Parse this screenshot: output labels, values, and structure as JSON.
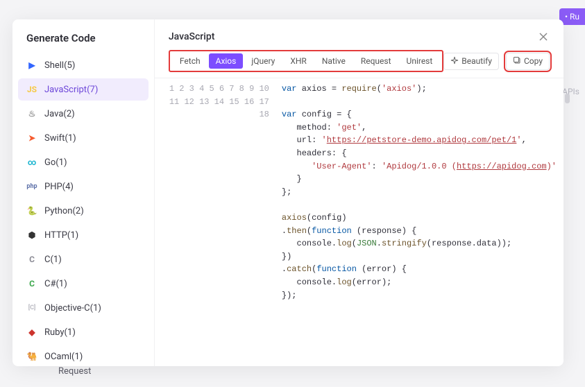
{
  "bg": {
    "run_btn": "Ru",
    "apis": "APIs",
    "request": "Request"
  },
  "sidebar": {
    "title": "Generate Code",
    "items": [
      {
        "label": "Shell(5)",
        "icon_name": "shell-icon",
        "icon_glyph": "▶",
        "icon_color": "#3366ff"
      },
      {
        "label": "JavaScript(7)",
        "icon_name": "javascript-icon",
        "icon_glyph": "JS",
        "icon_color": "#f6c945",
        "selected": true
      },
      {
        "label": "Java(2)",
        "icon_name": "java-icon",
        "icon_glyph": "♨",
        "icon_color": "#999"
      },
      {
        "label": "Swift(1)",
        "icon_name": "swift-icon",
        "icon_glyph": "➤",
        "icon_color": "#f55b2f"
      },
      {
        "label": "Go(1)",
        "icon_name": "go-icon",
        "icon_glyph": "∞",
        "icon_color": "#1fb6d0"
      },
      {
        "label": "PHP(4)",
        "icon_name": "php-icon",
        "icon_glyph": "php",
        "icon_color": "#5b6fa8"
      },
      {
        "label": "Python(2)",
        "icon_name": "python-icon",
        "icon_glyph": "🐍",
        "icon_color": "#3776ab"
      },
      {
        "label": "HTTP(1)",
        "icon_name": "http-icon",
        "icon_glyph": "⬢",
        "icon_color": "#333"
      },
      {
        "label": "C(1)",
        "icon_name": "c-icon",
        "icon_glyph": "C",
        "icon_color": "#8a8a94"
      },
      {
        "label": "C#(1)",
        "icon_name": "csharp-icon",
        "icon_glyph": "C",
        "icon_color": "#3aa64a"
      },
      {
        "label": "Objective-C(1)",
        "icon_name": "objc-icon",
        "icon_glyph": "[C]",
        "icon_color": "#bcbcc4"
      },
      {
        "label": "Ruby(1)",
        "icon_name": "ruby-icon",
        "icon_glyph": "◆",
        "icon_color": "#cc342d"
      },
      {
        "label": "OCaml(1)",
        "icon_name": "ocaml-icon",
        "icon_glyph": "🐫",
        "icon_color": "#e98b2d"
      }
    ]
  },
  "main": {
    "title": "JavaScript",
    "tabs": [
      "Fetch",
      "Axios",
      "jQuery",
      "XHR",
      "Native",
      "Request",
      "Unirest"
    ],
    "active_tab": "Axios",
    "actions": {
      "beautify": "Beautify",
      "copy": "Copy"
    }
  },
  "code": {
    "line_count": 18,
    "tokens": [
      [
        {
          "t": "kw",
          "v": "var"
        },
        {
          "t": "sp",
          "v": " "
        },
        {
          "t": "var",
          "v": "axios"
        },
        {
          "t": "sp",
          "v": " "
        },
        {
          "t": "op",
          "v": "="
        },
        {
          "t": "sp",
          "v": " "
        },
        {
          "t": "fn",
          "v": "require"
        },
        {
          "t": "op",
          "v": "("
        },
        {
          "t": "str",
          "v": "'axios'"
        },
        {
          "t": "op",
          "v": ");"
        }
      ],
      [],
      [
        {
          "t": "kw",
          "v": "var"
        },
        {
          "t": "sp",
          "v": " "
        },
        {
          "t": "var",
          "v": "config"
        },
        {
          "t": "sp",
          "v": " "
        },
        {
          "t": "op",
          "v": "="
        },
        {
          "t": "sp",
          "v": " "
        },
        {
          "t": "op",
          "v": "{"
        }
      ],
      [
        {
          "t": "sp",
          "v": "   "
        },
        {
          "t": "prop",
          "v": "method"
        },
        {
          "t": "op",
          "v": ": "
        },
        {
          "t": "str",
          "v": "'get'"
        },
        {
          "t": "op",
          "v": ","
        }
      ],
      [
        {
          "t": "sp",
          "v": "   "
        },
        {
          "t": "prop",
          "v": "url"
        },
        {
          "t": "op",
          "v": ": "
        },
        {
          "t": "str",
          "v": "'"
        },
        {
          "t": "link",
          "v": "https://petstore-demo.apidog.com/pet/1"
        },
        {
          "t": "str",
          "v": "'"
        },
        {
          "t": "op",
          "v": ","
        }
      ],
      [
        {
          "t": "sp",
          "v": "   "
        },
        {
          "t": "prop",
          "v": "headers"
        },
        {
          "t": "op",
          "v": ": { "
        }
      ],
      [
        {
          "t": "sp",
          "v": "      "
        },
        {
          "t": "str",
          "v": "'User-Agent'"
        },
        {
          "t": "op",
          "v": ": "
        },
        {
          "t": "str",
          "v": "'Apidog/1.0.0 ("
        },
        {
          "t": "link",
          "v": "https://apidog.com"
        },
        {
          "t": "str",
          "v": ")'"
        }
      ],
      [
        {
          "t": "sp",
          "v": "   "
        },
        {
          "t": "op",
          "v": "}"
        }
      ],
      [
        {
          "t": "op",
          "v": "};"
        }
      ],
      [],
      [
        {
          "t": "fn",
          "v": "axios"
        },
        {
          "t": "op",
          "v": "("
        },
        {
          "t": "var",
          "v": "config"
        },
        {
          "t": "op",
          "v": ")"
        }
      ],
      [
        {
          "t": "op",
          "v": "."
        },
        {
          "t": "fn",
          "v": "then"
        },
        {
          "t": "op",
          "v": "("
        },
        {
          "t": "kw",
          "v": "function"
        },
        {
          "t": "sp",
          "v": " "
        },
        {
          "t": "op",
          "v": "("
        },
        {
          "t": "var",
          "v": "response"
        },
        {
          "t": "op",
          "v": ") {"
        }
      ],
      [
        {
          "t": "sp",
          "v": "   "
        },
        {
          "t": "var",
          "v": "console"
        },
        {
          "t": "op",
          "v": "."
        },
        {
          "t": "fn",
          "v": "log"
        },
        {
          "t": "op",
          "v": "("
        },
        {
          "t": "json",
          "v": "JSON"
        },
        {
          "t": "op",
          "v": "."
        },
        {
          "t": "fn",
          "v": "stringify"
        },
        {
          "t": "op",
          "v": "("
        },
        {
          "t": "var",
          "v": "response"
        },
        {
          "t": "op",
          "v": "."
        },
        {
          "t": "var",
          "v": "data"
        },
        {
          "t": "op",
          "v": "));"
        }
      ],
      [
        {
          "t": "op",
          "v": "})"
        }
      ],
      [
        {
          "t": "op",
          "v": "."
        },
        {
          "t": "fn",
          "v": "catch"
        },
        {
          "t": "op",
          "v": "("
        },
        {
          "t": "kw",
          "v": "function"
        },
        {
          "t": "sp",
          "v": " "
        },
        {
          "t": "op",
          "v": "("
        },
        {
          "t": "var",
          "v": "error"
        },
        {
          "t": "op",
          "v": ") {"
        }
      ],
      [
        {
          "t": "sp",
          "v": "   "
        },
        {
          "t": "var",
          "v": "console"
        },
        {
          "t": "op",
          "v": "."
        },
        {
          "t": "fn",
          "v": "log"
        },
        {
          "t": "op",
          "v": "("
        },
        {
          "t": "var",
          "v": "error"
        },
        {
          "t": "op",
          "v": ");"
        }
      ],
      [
        {
          "t": "op",
          "v": "});"
        }
      ],
      []
    ]
  }
}
